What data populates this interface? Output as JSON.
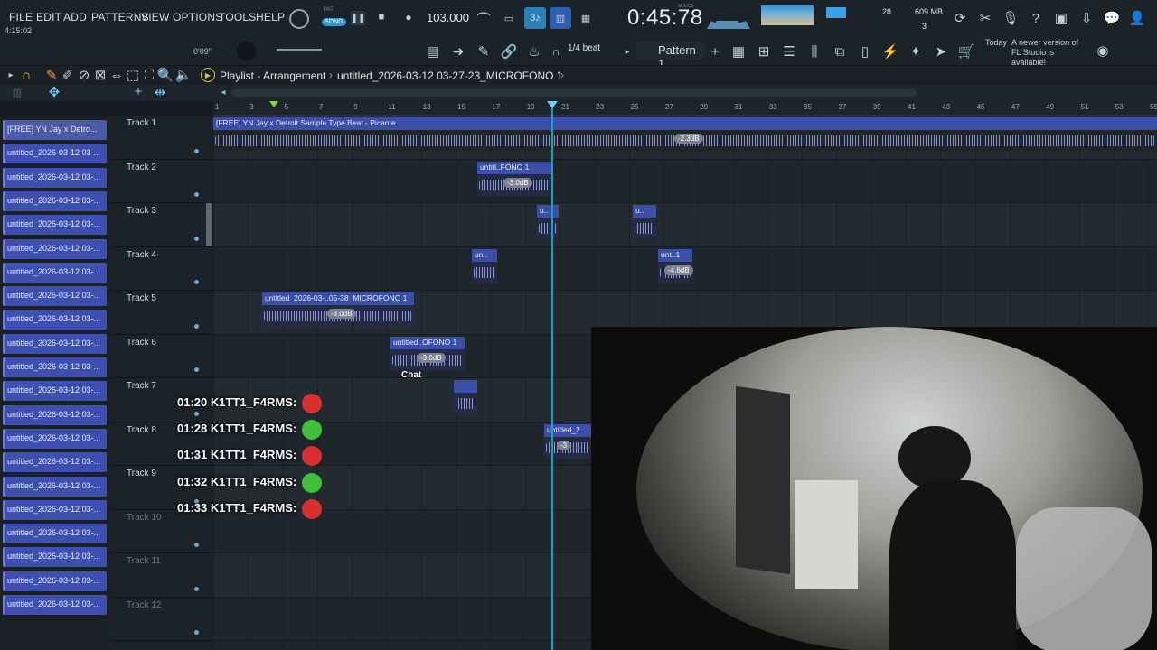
{
  "menu": [
    "FILE",
    "EDIT",
    "ADD",
    "PATTERNS",
    "VIEW",
    "OPTIONS",
    "TOOLS",
    "HELP"
  ],
  "transport": {
    "pat_label": "PAT",
    "song_label": "SONG",
    "tempo": "103.000",
    "time": "0:45:78",
    "time_unit": "M:S:CS",
    "cpu_count": "28",
    "memory": "609 MB",
    "mem_sub": "3",
    "hint_time": "4:15:02",
    "hint_left": "0'09\""
  },
  "toolbar": {
    "snap": "1/4 beat",
    "pattern": "Pattern 1",
    "update_title": "Today",
    "update_msg": "A newer version of FL Studio is available!"
  },
  "playlist": {
    "title": "Playlist - Arrangement",
    "path_sep": "›",
    "project": "untitled_2026-03-12 03-27-23_MICROFONO 1"
  },
  "ruler_ticks": [
    "1",
    "3",
    "5",
    "7",
    "9",
    "11",
    "13",
    "15",
    "17",
    "19",
    "21",
    "23",
    "25",
    "27",
    "29",
    "31",
    "33",
    "35",
    "37",
    "39",
    "41",
    "43",
    "45",
    "47",
    "49",
    "51",
    "53",
    "55"
  ],
  "clip_list": [
    "[FREE] YN Jay x Detro...",
    "untitled_2026-03-12 03-...",
    "untitled_2026-03-12 03-...",
    "untitled_2026-03-12 03-...",
    "untitled_2026-03-12 03-...",
    "untitled_2026-03-12 03-...",
    "untitled_2026-03-12 03-...",
    "untitled_2026-03-12 03-...",
    "untitled_2026-03-12 03-...",
    "untitled_2026-03-12 03-...",
    "untitled_2026-03-12 03-...",
    "untitled_2026-03-12 03-...",
    "untitled_2026-03-12 03-...",
    "untitled_2026-03-12 03-...",
    "untitled_2026-03-12 03-...",
    "untitled_2026-03-12 03-...",
    "untitled_2026-03-12 03-...",
    "untitled_2026-03-12 03-...",
    "untitled_2026-03-12 03-...",
    "untitled_2026-03-12 03-...",
    "untitled_2026-03-12 03-..."
  ],
  "tracks": [
    "Track 1",
    "Track 2",
    "Track 3",
    "Track 4",
    "Track 5",
    "Track 6",
    "Track 7",
    "Track 8",
    "Track 9",
    "Track 10",
    "Track 11",
    "Track 12"
  ],
  "clips": {
    "beat": {
      "label": "[FREE] YN Jay x Detroit Sample Type Beat - Picante",
      "db": "-2.3dB"
    },
    "c2": {
      "label": "untitl..FONO 1",
      "db": "-3.0dB"
    },
    "c3a": {
      "label": "u.."
    },
    "c3b": {
      "label": "u.."
    },
    "c4a": {
      "label": "un.."
    },
    "c4b": {
      "label": "unt..1",
      "db": "-4.6dB"
    },
    "c5": {
      "label": "untitled_2026-03-..05-38_MICROFONO 1",
      "db": "-3.0dB"
    },
    "c6": {
      "label": "untitled..OFONO 1",
      "db": "-3.0dB"
    },
    "c7": {
      "label": ""
    },
    "c8": {
      "label": "untitled_2",
      "db": "-3"
    }
  },
  "chat": {
    "label": "Chat",
    "messages": [
      {
        "time": "01:20",
        "user": "K1TT1_F4RMS:",
        "emote": "red"
      },
      {
        "time": "01:28",
        "user": "K1TT1_F4RMS:",
        "emote": "green"
      },
      {
        "time": "01:31",
        "user": "K1TT1_F4RMS:",
        "emote": "red"
      },
      {
        "time": "01:32",
        "user": "K1TT1_F4RMS:",
        "emote": "green"
      },
      {
        "time": "01:33",
        "user": "K1TT1_F4RMS:",
        "emote": "red"
      }
    ]
  },
  "colors": {
    "clip_header": "#3b4ea8",
    "playhead": "#1aa0c8",
    "accent": "#3aa0e8"
  }
}
